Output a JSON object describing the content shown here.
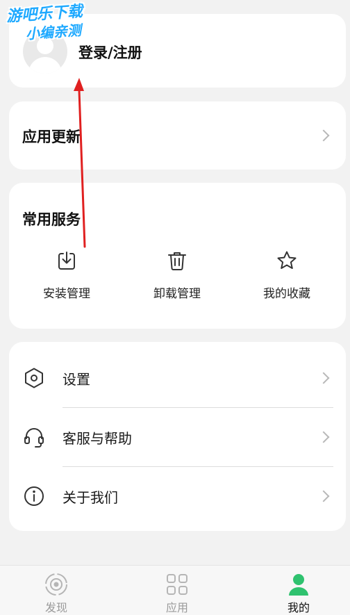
{
  "watermark": {
    "line1": "游吧乐下载",
    "line2": "小编亲测"
  },
  "login": {
    "label": "登录/注册"
  },
  "update": {
    "label": "应用更新"
  },
  "services": {
    "title": "常用服务",
    "items": [
      {
        "label": "安装管理",
        "icon": "download-box-icon"
      },
      {
        "label": "卸载管理",
        "icon": "trash-icon"
      },
      {
        "label": "我的收藏",
        "icon": "star-icon"
      }
    ]
  },
  "settings": {
    "items": [
      {
        "label": "设置",
        "icon": "hexagon-settings-icon"
      },
      {
        "label": "客服与帮助",
        "icon": "headset-icon"
      },
      {
        "label": "关于我们",
        "icon": "info-icon"
      }
    ]
  },
  "nav": {
    "items": [
      {
        "label": "发现",
        "icon": "discover-icon",
        "active": false
      },
      {
        "label": "应用",
        "icon": "apps-grid-icon",
        "active": false
      },
      {
        "label": "我的",
        "icon": "person-icon",
        "active": true
      }
    ]
  },
  "colors": {
    "accent": "#2fc26f",
    "annotation": "#e02020",
    "watermark": "#1ea9ff"
  }
}
